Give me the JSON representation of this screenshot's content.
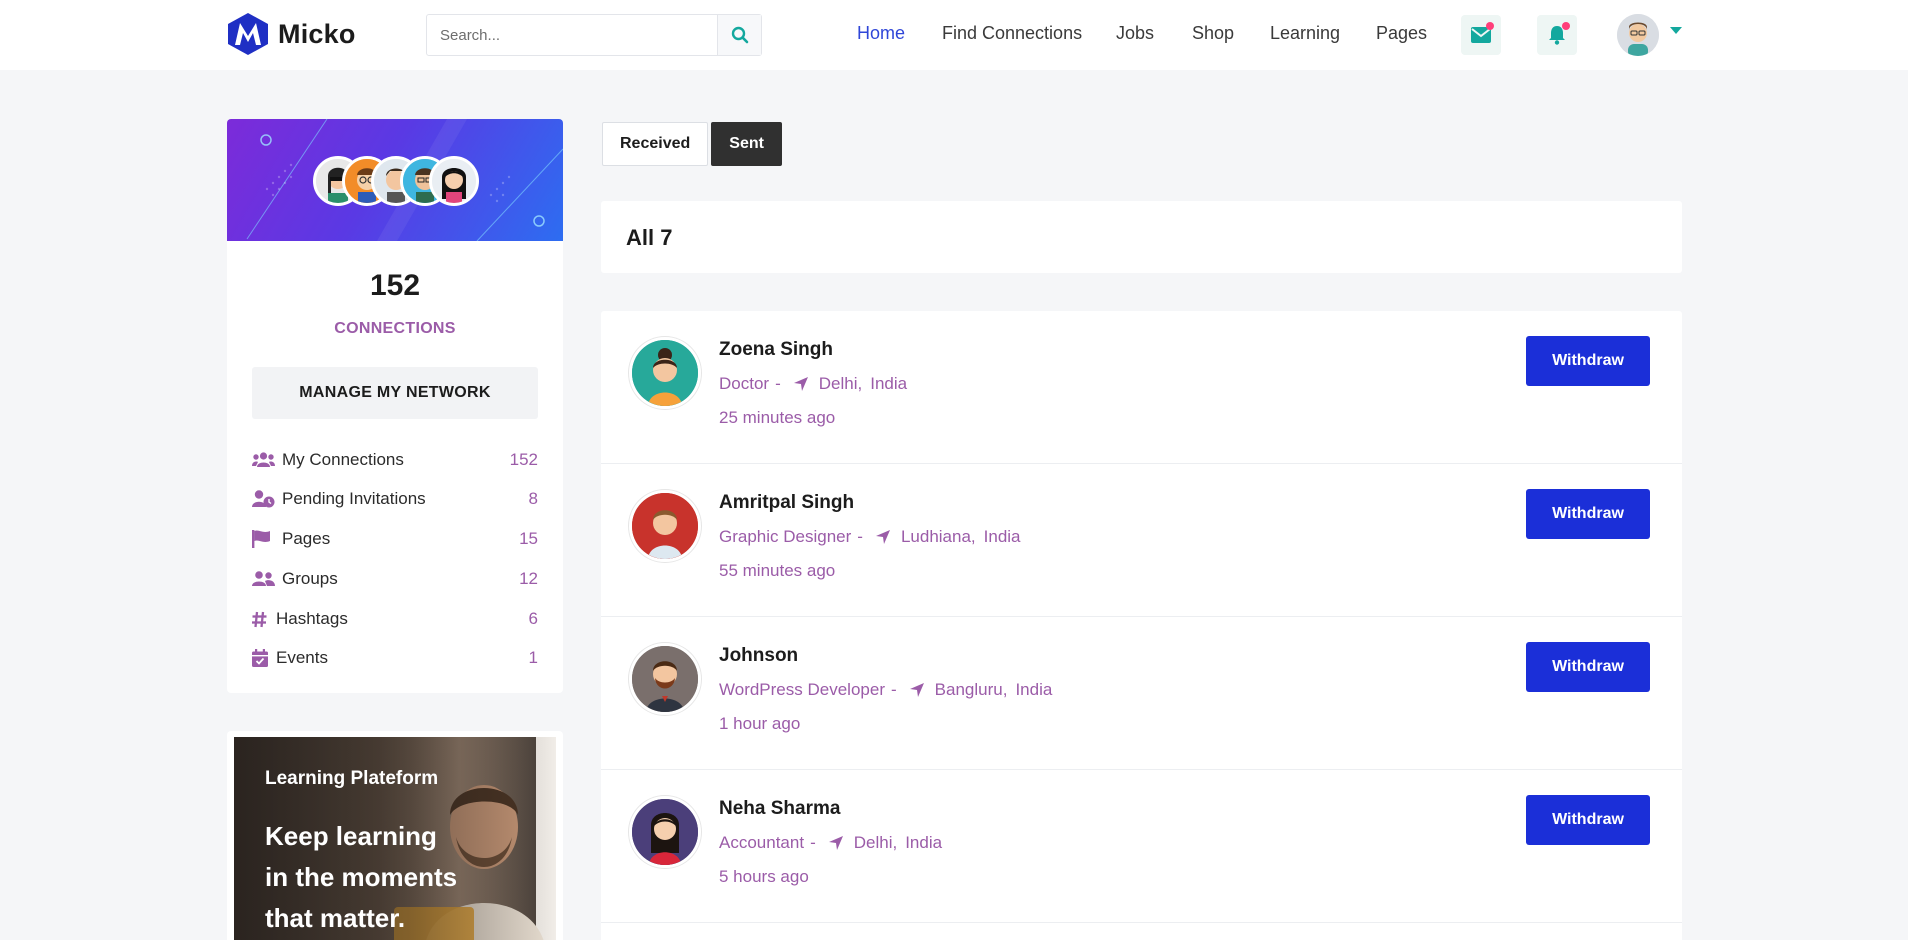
{
  "brand": {
    "name": "Micko",
    "accent": "#2f46d8",
    "button_color": "#1b2fd8",
    "muted_color": "#9b5ca8"
  },
  "search": {
    "placeholder": "Search...",
    "value": "",
    "icon": "search-icon"
  },
  "nav": {
    "items": [
      {
        "label": "Home",
        "active": true
      },
      {
        "label": "Find Connections"
      },
      {
        "label": "Jobs"
      },
      {
        "label": "Shop"
      },
      {
        "label": "Learning"
      },
      {
        "label": "Pages"
      }
    ],
    "icons": [
      "mail-icon",
      "bell-icon",
      "user-avatar",
      "caret-down-icon"
    ]
  },
  "profile": {
    "connections_count": "152",
    "connections_label": "CONNECTIONS",
    "manage_label": "MANAGE MY NETWORK",
    "menu": [
      {
        "icon": "users-icon",
        "label": "My Connections",
        "count": "152"
      },
      {
        "icon": "user-clock-icon",
        "label": "Pending Invitations",
        "count": "8"
      },
      {
        "icon": "flag-icon",
        "label": "Pages",
        "count": "15"
      },
      {
        "icon": "user-group-icon",
        "label": "Groups",
        "count": "12"
      },
      {
        "icon": "hashtag-icon",
        "label": "Hashtags",
        "count": "6"
      },
      {
        "icon": "calendar-check-icon",
        "label": "Events",
        "count": "1"
      }
    ]
  },
  "learning_banner": {
    "subtitle": "Learning Plateform",
    "title": "Keep learning in the moments that matter."
  },
  "tabs": [
    {
      "label": "Received",
      "active": false
    },
    {
      "label": "Sent",
      "active": true
    }
  ],
  "all_heading": "All 7",
  "requests": [
    {
      "name": "Zoena Singh",
      "role": "Doctor",
      "city": "Delhi,",
      "country": "India",
      "time": "25 minutes ago",
      "action": "Withdraw"
    },
    {
      "name": "Amritpal Singh",
      "role": "Graphic Designer",
      "city": "Ludhiana,",
      "country": "India",
      "time": "55 minutes ago",
      "action": "Withdraw"
    },
    {
      "name": "Johnson",
      "role": "WordPress Developer",
      "city": "Bangluru,",
      "country": "India",
      "time": "1 hour ago",
      "action": "Withdraw"
    },
    {
      "name": "Neha Sharma",
      "role": "Accountant",
      "city": "Delhi,",
      "country": "India",
      "time": "5 hours ago",
      "action": "Withdraw"
    }
  ]
}
